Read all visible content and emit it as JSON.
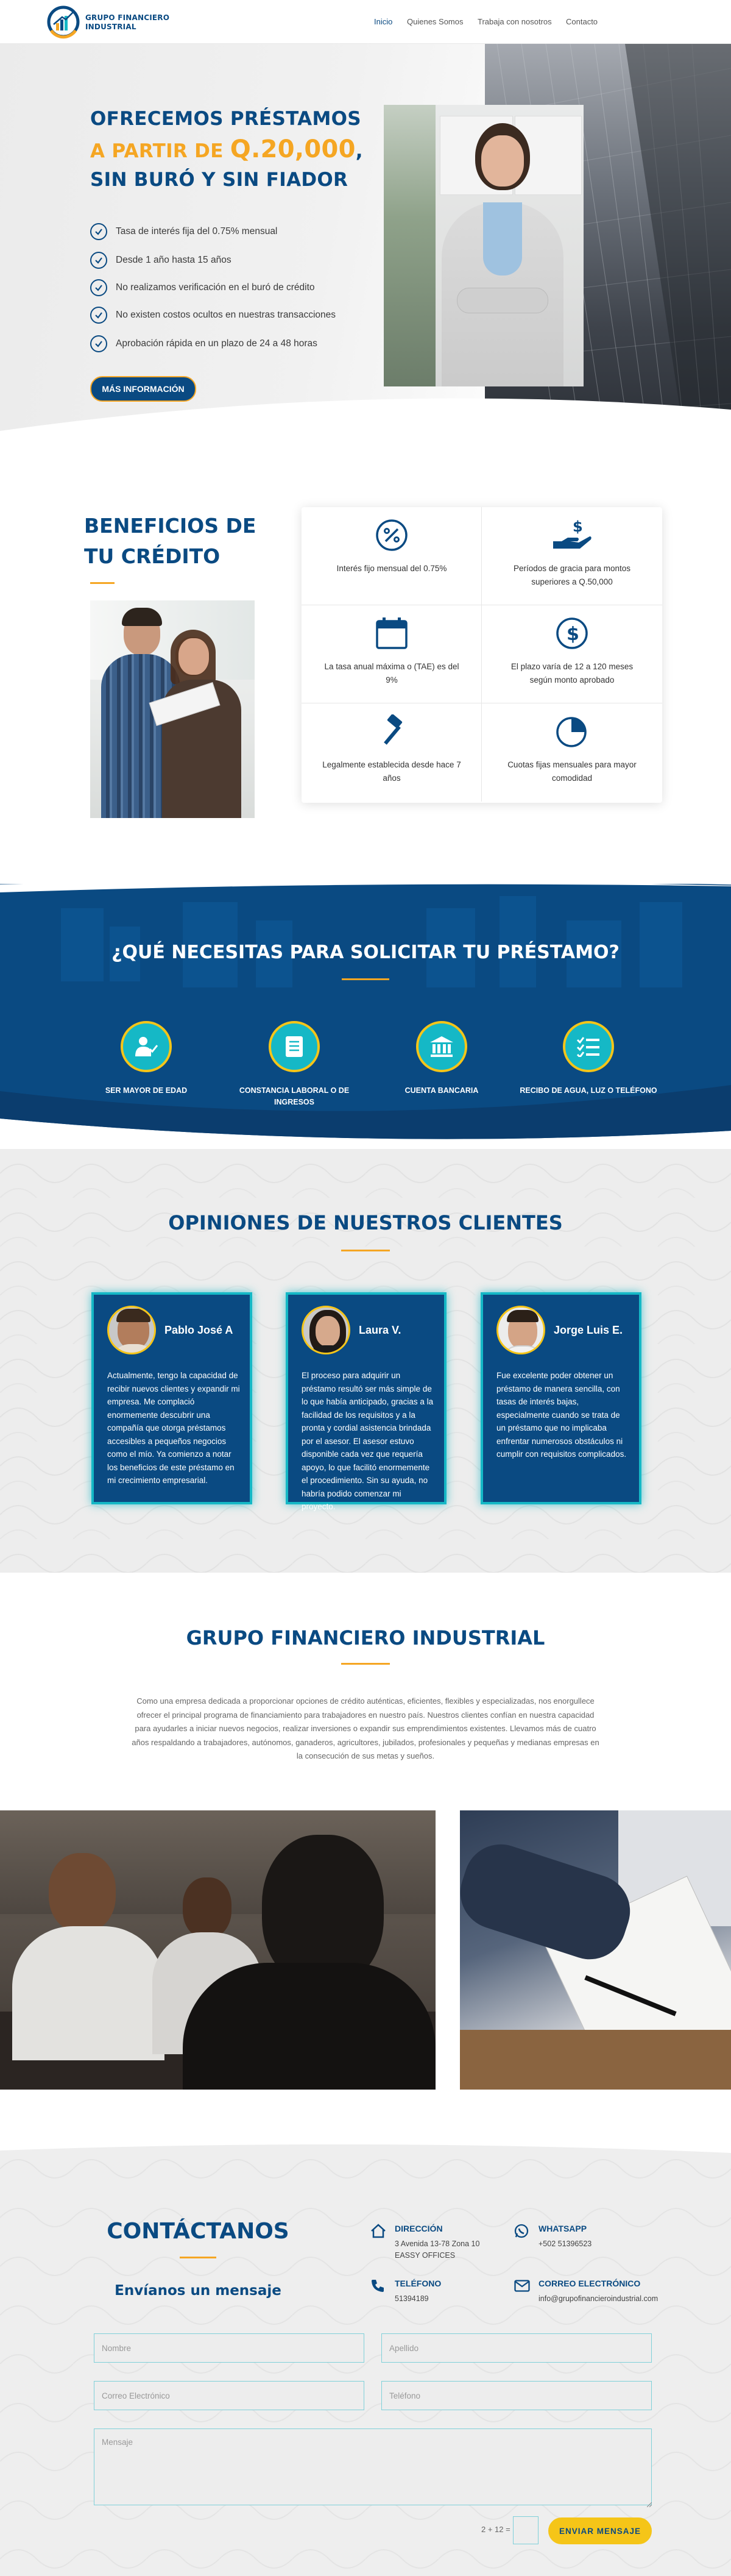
{
  "header": {
    "logo_line1": "GRUPO FINANCIERO",
    "logo_line2": "INDUSTRIAL",
    "nav": [
      "Inicio",
      "Quienes Somos",
      "Trabaja con nosotros",
      "Contacto"
    ]
  },
  "hero": {
    "line1": "OFRECEMOS PRÉSTAMOS",
    "line2a": "A PARTIR DE ",
    "line2b": "Q.20,000",
    "line2c": ",",
    "line3": "SIN BURÓ Y SIN FIADOR",
    "bullets": [
      "Tasa de interés fija del 0.75% mensual",
      "Desde 1 año hasta 15 años",
      "No realizamos verificación en el buró de crédito",
      "No existen costos ocultos en nuestras transacciones",
      "Aprobación rápida en un plazo de 24 a 48 horas"
    ],
    "cta": "MÁS INFORMACIÓN"
  },
  "benefits": {
    "title": "BENEFICIOS DE TU CRÉDITO",
    "items": [
      {
        "icon": "percent-icon",
        "label": "Interés fijo mensual del 0.75%"
      },
      {
        "icon": "hand-money-icon",
        "label": "Períodos de gracia para montos superiores a Q.50,000"
      },
      {
        "icon": "calendar-icon",
        "label": "La tasa anual máxima o (TAE) es del 9%"
      },
      {
        "icon": "dollar-circle-icon",
        "label": "El plazo varía de 12 a 120 meses según monto aprobado"
      },
      {
        "icon": "gavel-icon",
        "label": "Legalmente establecida desde hace 7 años"
      },
      {
        "icon": "pie-chart-icon",
        "label": "Cuotas fijas mensuales para mayor comodidad"
      }
    ]
  },
  "requirements": {
    "title": "¿QUÉ NECESITAS PARA SOLICITAR TU PRÉSTAMO?",
    "items": [
      {
        "icon": "user-check-icon",
        "label": "SER MAYOR DE EDAD"
      },
      {
        "icon": "document-icon",
        "label": "CONSTANCIA LABORAL O DE INGRESOS"
      },
      {
        "icon": "bank-icon",
        "label": "CUENTA BANCARIA"
      },
      {
        "icon": "checklist-icon",
        "label": "RECIBO DE AGUA, LUZ O TELÉFONO"
      }
    ]
  },
  "testimonials": {
    "title": "OPINIONES DE NUESTROS CLIENTES",
    "items": [
      {
        "name": "Pablo José A",
        "text": "Actualmente, tengo la capacidad de recibir nuevos clientes y expandir mi empresa. Me complació enormemente descubrir una compañía que otorga préstamos accesibles a pequeños negocios como el mío. Ya comienzo a notar los beneficios de este préstamo en mi crecimiento empresarial."
      },
      {
        "name": "Laura V.",
        "text": "El proceso para adquirir un préstamo resultó ser más simple de lo que había anticipado, gracias a la facilidad de los requisitos y a la pronta y cordial asistencia brindada por el asesor. El asesor estuvo disponible cada vez que requería apoyo, lo que facilitó enormemente el procedimiento. Sin su ayuda, no habría podido comenzar mi proyecto."
      },
      {
        "name": "Jorge Luis E.",
        "text": "Fue excelente poder obtener un préstamo de manera sencilla, con tasas de interés bajas, especialmente cuando se trata de un préstamo que no implicaba enfrentar numerosos obstáculos ni cumplir con requisitos complicados."
      }
    ]
  },
  "about": {
    "title": "GRUPO FINANCIERO INDUSTRIAL",
    "text": "Como una empresa dedicada a proporcionar opciones de crédito auténticas, eficientes, flexibles y especializadas, nos enorgullece ofrecer el principal programa de financiamiento para trabajadores en nuestro país. Nuestros clientes confían en nuestra capacidad para ayudarles a iniciar nuevos negocios, realizar inversiones o expandir sus emprendimientos existentes. Llevamos más de cuatro años respaldando a trabajadores, autónomos, ganaderos, agricultores, jubilados, profesionales y pequeñas y medianas empresas en la consecución de sus metas y sueños."
  },
  "contact": {
    "title": "CONTÁCTANOS",
    "subtitle": "Envíanos un mensaje",
    "direccion_label": "DIRECCIÓN",
    "direccion_text": [
      "3 Avenida 13-78 Zona 10",
      "EASSY OFFICES"
    ],
    "whatsapp_label": "WHATSAPP",
    "whatsapp_text": "+502 51396523",
    "telefono_label": "TELÉFONO",
    "telefono_text": "51394189",
    "correo_label": "CORREO ELECTRÓNICO",
    "correo_text": "info@grupofinancieroindustrial.com",
    "fields": {
      "nombre": "Nombre",
      "apellido": "Apellido",
      "correo": "Correo Electrónico",
      "telefono": "Teléfono",
      "mensaje": "Mensaje"
    },
    "captcha": "2 + 12 =",
    "submit": "ENVIAR MENSAJE"
  },
  "colors": {
    "primary": "#0a4a82",
    "accent": "#f5a623",
    "teal": "#15b8c6"
  }
}
